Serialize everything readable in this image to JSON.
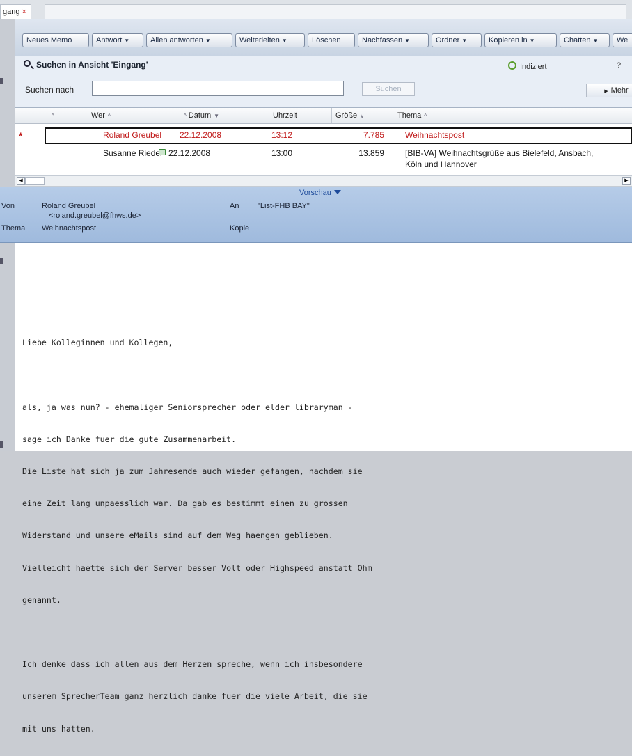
{
  "tab": {
    "label": "gang",
    "close": "×"
  },
  "toolbar": {
    "buttons": [
      {
        "label": "Neues Memo",
        "dropdown": false
      },
      {
        "label": "Antwort",
        "dropdown": true
      },
      {
        "label": "Allen antworten",
        "dropdown": true
      },
      {
        "label": "Weiterleiten",
        "dropdown": true
      },
      {
        "label": "Löschen",
        "dropdown": false
      },
      {
        "label": "Nachfassen",
        "dropdown": true
      },
      {
        "label": "Ordner",
        "dropdown": true
      },
      {
        "label": "Kopieren in",
        "dropdown": true
      },
      {
        "label": "Chatten",
        "dropdown": true
      },
      {
        "label": "We",
        "dropdown": false
      }
    ]
  },
  "search": {
    "title": "Suchen in Ansicht 'Eingang'",
    "indexed_label": "Indiziert",
    "help": "?",
    "field_label": "Suchen nach",
    "query": "",
    "button_label": "Suchen",
    "more_label": "Mehr"
  },
  "columns": [
    {
      "label": "Wer",
      "sort": "^"
    },
    {
      "label": "Datum",
      "sort": "▼"
    },
    {
      "label": "Uhrzeit",
      "sort": ""
    },
    {
      "label": "Größe",
      "sort": "∨"
    },
    {
      "label": "Thema",
      "sort": "^"
    }
  ],
  "messages": [
    {
      "unread": "*",
      "from": "Roland Greubel",
      "date": "22.12.2008",
      "time": "13:12",
      "size": "7.785",
      "subject": "Weihnachtspost",
      "subject2": ""
    },
    {
      "unread": "",
      "from": "Susanne Riedel",
      "date": "22.12.2008",
      "time": "13:00",
      "size": "13.859",
      "subject": "[BIB-VA] Weihnachtsgrüße aus Bielefeld, Ansbach,",
      "subject2": "Köln und Hannover"
    }
  ],
  "preview": {
    "toggle_label": "Vorschau",
    "von_label": "Von",
    "von_name": "Roland Greubel",
    "von_email": "<roland.greubel@fhws.de>",
    "an_label": "An",
    "an_value": "\"List-FHB BAY\"",
    "thema_label": "Thema",
    "thema_value": "Weihnachtspost",
    "kopie_label": "Kopie"
  },
  "body_lines": [
    "",
    "",
    "Liebe Kolleginnen und Kollegen,",
    "",
    "als, ja was nun? - ehemaliger Seniorsprecher oder elder libraryman -",
    "sage ich Danke fuer die gute Zusammenarbeit.",
    "Die Liste hat sich ja zum Jahresende auch wieder gefangen, nachdem sie",
    "eine Zeit lang unpaesslich war. Da gab es bestimmt einen zu grossen",
    "Widerstand und unsere eMails sind auf dem Weg haengen geblieben.",
    "Vielleicht haette sich der Server besser Volt oder Highspeed anstatt Ohm",
    "genannt.",
    "",
    "Ich denke dass ich allen aus dem Herzen spreche, wenn ich insbesondere",
    "unserem SprecherTeam ganz herzlich danke fuer die viele Arbeit, die sie",
    "mit uns hatten."
  ]
}
